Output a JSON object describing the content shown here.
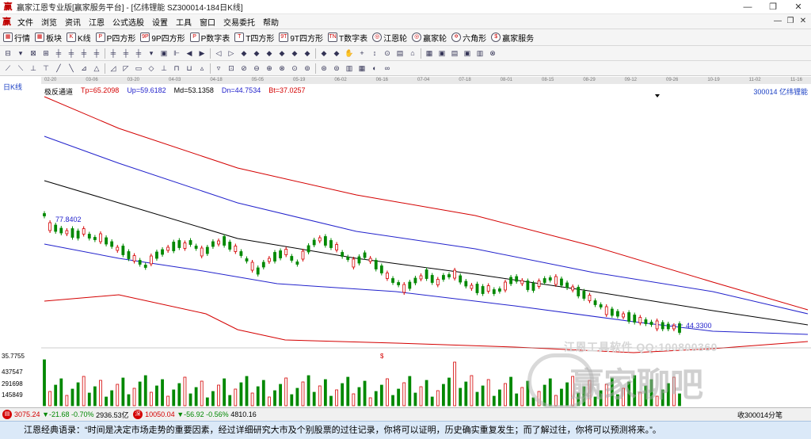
{
  "window": {
    "app_icon": "赢",
    "title": "赢家江恩专业版[赢家服务平台] - [亿纬锂能  SZ300014-184日K线]",
    "minimize": "—",
    "maximize": "❐",
    "close": "✕"
  },
  "menu": {
    "items": [
      "文件",
      "浏览",
      "资讯",
      "江恩",
      "公式选股",
      "设置",
      "工具",
      "窗口",
      "交易委托",
      "帮助"
    ]
  },
  "toolbar1": {
    "items": [
      {
        "icon": "grid-icon",
        "glyph": "▦",
        "label": "行情"
      },
      {
        "icon": "blocks-icon",
        "glyph": "▦",
        "label": "板块"
      },
      {
        "icon": "kline-icon",
        "glyph": "K",
        "label": "K线"
      },
      {
        "icon": "square-icon",
        "glyph": "P",
        "label": "P四方形"
      },
      {
        "icon": "square-icon",
        "glyph": "9P",
        "label": "9P四方形"
      },
      {
        "icon": "digit-icon",
        "glyph": "P",
        "label": "P数字表"
      },
      {
        "icon": "square-icon",
        "glyph": "T",
        "label": "T四方形"
      },
      {
        "icon": "square-icon",
        "glyph": "9T",
        "label": "9T四方形"
      },
      {
        "icon": "digit-icon",
        "glyph": "TN",
        "label": "T数字表"
      },
      {
        "icon": "wheel-icon",
        "glyph": "◎",
        "label": "江恩轮"
      },
      {
        "icon": "wheel-icon",
        "glyph": "◎",
        "label": "赢家轮"
      },
      {
        "icon": "hexagon-icon",
        "glyph": "✡",
        "label": "六角形"
      },
      {
        "icon": "dollar-icon",
        "glyph": "$",
        "label": "赢家服务"
      }
    ]
  },
  "toolbar2_glyphs": [
    "⊟",
    "▾",
    "⊠",
    "⊞",
    "╪",
    "╪",
    "╪",
    "╪",
    "╪",
    "╪",
    "╪",
    "▾",
    "▣",
    "⊩",
    "◀",
    "▶",
    "◁",
    "▷",
    "◆",
    "◆",
    "◆",
    "◆",
    "◆",
    "◆",
    "◆",
    "◆",
    "✋",
    "+",
    "↕",
    "⊙",
    "▤",
    "⌂",
    "▦",
    "▣",
    "▤",
    "▣",
    "▥",
    "⊗"
  ],
  "toolbar3_glyphs": [
    "⟋",
    "⟍",
    "⊥",
    "⊤",
    "╱",
    "╲",
    "⊿",
    "△",
    "◿",
    "◸",
    "▭",
    "◇",
    "⊥",
    "⊓",
    "⊔",
    "▵",
    "▿",
    "⊡",
    "⊘",
    "⊖",
    "⊕",
    "⊗",
    "⊙",
    "⊚",
    "⊛",
    "⊜",
    "▥",
    "▦",
    "◐",
    "∞"
  ],
  "chart": {
    "period_label": "日K线",
    "date_ticks": [
      "02-20",
      "03-06",
      "03-20",
      "04-03",
      "04-18",
      "05-05",
      "05-19",
      "06-02",
      "06-16",
      "07-04",
      "07-18",
      "08-01",
      "08-15",
      "08-29",
      "09-12",
      "09-26",
      "10-19",
      "11-02",
      "11-16"
    ],
    "indicator_name": "极反通道",
    "tp": "Tp=65.2098",
    "up": "Up=59.6182",
    "md": "Md=53.1358",
    "dn": "Dn=44.7534",
    "bt": "Bt=37.0257",
    "stock_code": "300014",
    "stock_name": "亿纬锂能",
    "high_label": "77.8402",
    "low_label": "44.3300",
    "volume_marker": "$",
    "vol_axis_labels": [
      "35.7755",
      "437547",
      "291698",
      "145849"
    ],
    "colors": {
      "tp_line": "#d40000",
      "up_line": "#2222cc",
      "md_line": "#000000",
      "dn_line": "#2222cc",
      "bt_line": "#d40000",
      "candle_up": "#d40000",
      "candle_down": "#008800"
    }
  },
  "watermark": {
    "contact": "江恩工具软件  QQ:100800360",
    "brand": "赢家聊吧"
  },
  "status": {
    "sh_index": "3075.24",
    "sh_change": "▼-21.68",
    "sh_pct": "-0.70%",
    "sh_amount": "2936.53亿",
    "sz_index": "10050.04",
    "sz_change": "▼-56.92",
    "sz_pct": "-0.56%",
    "sz_amount": "4810.16",
    "right_label": "收300014分笔"
  },
  "quote": "江恩经典语录：“时间是决定市场走势的重要因素，经过详细研究大市及个别股票的过往记录，你将可以证明，历史确实重复发生；而了解过往，你将可以预测将来。”。"
}
